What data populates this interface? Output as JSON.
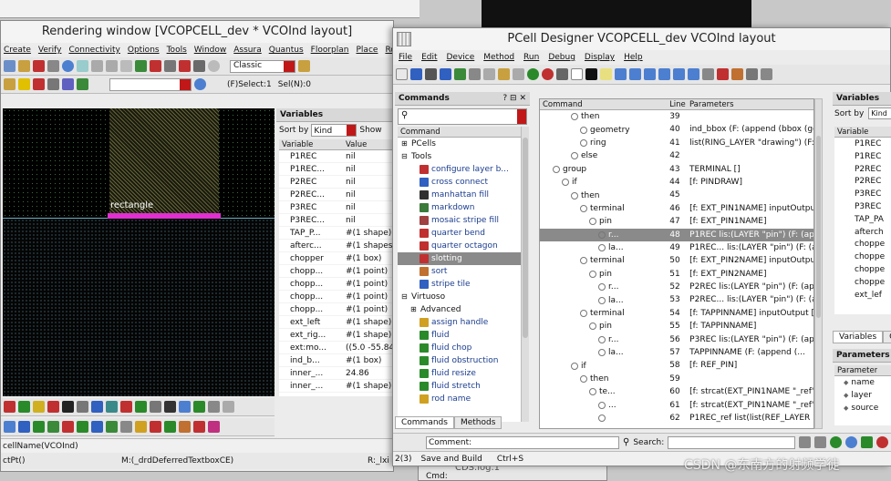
{
  "left_window": {
    "title": "Rendering window [VCOPCELL_dev * VCOInd layout]",
    "menu": [
      "Create",
      "Verify",
      "Connectivity",
      "Options",
      "Tools",
      "Window",
      "Assura",
      "Quantus",
      "Floorplan",
      "Place",
      "Route"
    ],
    "combo_value": "Classic",
    "select_label": "(F)Select:1",
    "sel_label": "Sel(N):0",
    "canvas_label": "rectangle",
    "variables_title": "Variables",
    "sort_by_label": "Sort by",
    "sort_value": "Kind",
    "show_label": "Show",
    "columns": [
      "Variable",
      "Value"
    ],
    "rows": [
      {
        "name": "P1REC",
        "value": "nil"
      },
      {
        "name": "P1REC...",
        "value": "nil"
      },
      {
        "name": "P2REC",
        "value": "nil"
      },
      {
        "name": "P2REC...",
        "value": "nil"
      },
      {
        "name": "P3REC",
        "value": "nil"
      },
      {
        "name": "P3REC...",
        "value": "nil"
      },
      {
        "name": "TAP_P...",
        "value": "#(1 shape)"
      },
      {
        "name": "afterc...",
        "value": "#(1 shapes)"
      },
      {
        "name": "chopper",
        "value": "#(1 box)"
      },
      {
        "name": "chopp...",
        "value": "#(1 point)"
      },
      {
        "name": "chopp...",
        "value": "#(1 point)"
      },
      {
        "name": "chopp...",
        "value": "#(1 point)"
      },
      {
        "name": "chopp...",
        "value": "#(1 point)"
      },
      {
        "name": "ext_left",
        "value": "#(1 shape)"
      },
      {
        "name": "ext_rig...",
        "value": "#(1 shape)"
      },
      {
        "name": "ext:mo...",
        "value": "((5.0 -55.84"
      },
      {
        "name": "ind_b...",
        "value": "#(1 box)"
      },
      {
        "name": "inner_...",
        "value": "24.86"
      },
      {
        "name": "inner_...",
        "value": "#(1 shape)"
      }
    ],
    "status_1": "cellName(VCOInd)",
    "status_2": "ctPt()",
    "status_3": "M:(_drdDeferredTextboxCE)",
    "status_4": "R:_lxi"
  },
  "right_window": {
    "title": "PCell Designer VCOPCELL_dev VCOInd layout",
    "menu": [
      "File",
      "Edit",
      "Device",
      "Method",
      "Run",
      "Debug",
      "Display",
      "Help"
    ],
    "commands_title": "Commands",
    "commands_header": "Command",
    "commands_tree": [
      {
        "label": "PCells",
        "indent": 0,
        "exp": "+"
      },
      {
        "label": "Tools",
        "indent": 0,
        "exp": "-"
      },
      {
        "label": "configure layer b...",
        "indent": 2,
        "icon": "#c03030"
      },
      {
        "label": "cross connect",
        "indent": 2,
        "icon": "#3060c0"
      },
      {
        "label": "manhattan fill",
        "indent": 2,
        "icon": "#303030"
      },
      {
        "label": "markdown",
        "indent": 2,
        "icon": "#3a7a3a"
      },
      {
        "label": "mosaic stripe fill",
        "indent": 2,
        "icon": "#a04040"
      },
      {
        "label": "quarter bend",
        "indent": 2,
        "icon": "#c03030"
      },
      {
        "label": "quarter octagon",
        "indent": 2,
        "icon": "#c03030"
      },
      {
        "label": "slotting",
        "indent": 2,
        "icon": "#c03030",
        "selected": true
      },
      {
        "label": "sort",
        "indent": 2,
        "icon": "#c07030"
      },
      {
        "label": "stripe tile",
        "indent": 2,
        "icon": "#3060c0"
      },
      {
        "label": "Virtuoso",
        "indent": 0,
        "exp": "-"
      },
      {
        "label": "Advanced",
        "indent": 1,
        "exp": "+"
      },
      {
        "label": "assign handle",
        "indent": 2,
        "icon": "#d0a020"
      },
      {
        "label": "fluid",
        "indent": 2,
        "icon": "#2a8a2a"
      },
      {
        "label": "fluid chop",
        "indent": 2,
        "icon": "#2a8a2a"
      },
      {
        "label": "fluid obstruction",
        "indent": 2,
        "icon": "#2a8a2a"
      },
      {
        "label": "fluid resize",
        "indent": 2,
        "icon": "#2a8a2a"
      },
      {
        "label": "fluid stretch",
        "indent": 2,
        "icon": "#2a8a2a"
      },
      {
        "label": "rod name",
        "indent": 2,
        "icon": "#d0a020"
      }
    ],
    "bottom_tabs": [
      "Commands",
      "Methods"
    ],
    "code_columns": [
      "Command",
      "Line",
      "Parameters"
    ],
    "code_rows": [
      {
        "cmd": "then",
        "indent": 3,
        "line": "39",
        "param": ""
      },
      {
        "cmd": "geometry",
        "indent": 4,
        "line": "40",
        "param": "ind_bbox (F: (append (bbox (geo..."
      },
      {
        "cmd": "ring",
        "indent": 4,
        "line": "41",
        "param": "list(RING_LAYER \"drawing\") (F: (a..."
      },
      {
        "cmd": "else",
        "indent": 3,
        "line": "42",
        "param": ""
      },
      {
        "cmd": "group",
        "indent": 1,
        "line": "43",
        "param": "TERMINAL []"
      },
      {
        "cmd": "if",
        "indent": 2,
        "line": "44",
        "param": "[f: PINDRAW]"
      },
      {
        "cmd": "then",
        "indent": 3,
        "line": "45",
        "param": ""
      },
      {
        "cmd": "terminal",
        "indent": 4,
        "line": "46",
        "param": "[f: EXT_PIN1NAME] inputOutput ..."
      },
      {
        "cmd": "pin",
        "indent": 5,
        "line": "47",
        "param": "[f: EXT_PIN1NAME]"
      },
      {
        "cmd": "r...",
        "indent": 6,
        "line": "48",
        "param": "P1REC lis:(LAYER \"pin\") (F: (appe...",
        "selected": true
      },
      {
        "cmd": "la...",
        "indent": 6,
        "line": "49",
        "param": "P1REC... lis:(LAYER \"pin\") (F: (append (..."
      },
      {
        "cmd": "terminal",
        "indent": 4,
        "line": "50",
        "param": "[f: EXT_PIN2NAME] inputOutput"
      },
      {
        "cmd": "pin",
        "indent": 5,
        "line": "51",
        "param": "[f: EXT_PIN2NAME]"
      },
      {
        "cmd": "r...",
        "indent": 6,
        "line": "52",
        "param": "P2REC lis:(LAYER \"pin\") (F: (appe..."
      },
      {
        "cmd": "la...",
        "indent": 6,
        "line": "53",
        "param": "P2REC... lis:(LAYER \"pin\") (F: (append (..."
      },
      {
        "cmd": "terminal",
        "indent": 4,
        "line": "54",
        "param": "[f: TAPPINNAME] inputOutput []"
      },
      {
        "cmd": "pin",
        "indent": 5,
        "line": "55",
        "param": "[f: TAPPINNAME]"
      },
      {
        "cmd": "r...",
        "indent": 6,
        "line": "56",
        "param": "P3REC lis:(LAYER \"pin\") (F: (appe..."
      },
      {
        "cmd": "la...",
        "indent": 6,
        "line": "57",
        "param": "TAPPINNAME (F: (append (..."
      },
      {
        "cmd": "if",
        "indent": 3,
        "line": "58",
        "param": "[f: REF_PIN]"
      },
      {
        "cmd": "then",
        "indent": 4,
        "line": "59",
        "param": ""
      },
      {
        "cmd": "te...",
        "indent": 5,
        "line": "60",
        "param": "[f: strcat(EXT_PIN1NAME \"_ref\")]"
      },
      {
        "cmd": "...",
        "indent": 6,
        "line": "61",
        "param": "[f: strcat(EXT_PIN1NAME \"_ref\")]"
      },
      {
        "cmd": "",
        "indent": 6,
        "line": "62",
        "param": "P1REC_ref list(list(REF_LAYER \"pin..."
      }
    ],
    "variables_title": "Variables",
    "sort_by_label": "Sort by",
    "sort_value": "Kind",
    "var_header": "Variable",
    "variables": [
      "P1REC",
      "P1REC",
      "P2REC",
      "P2REC",
      "P3REC",
      "P3REC",
      "TAP_PA",
      "afterch",
      "choppe",
      "choppe",
      "choppe",
      "choppe",
      "ext_lef"
    ],
    "var_tabs": [
      "Variables",
      "Ge"
    ],
    "params_title": "Parameters",
    "params_header": "Parameter",
    "params": [
      "name",
      "layer",
      "source"
    ],
    "comment_label": "Comment:",
    "search_label": "Search:",
    "status_left": "2(3)",
    "status_mid": "Save and Build",
    "status_right": "Ctrl+S"
  },
  "background": {
    "cds_log": "CDS.log.1",
    "cmd_label": "Cmd:"
  },
  "watermark": "CSDN @东南方的射频学徒"
}
